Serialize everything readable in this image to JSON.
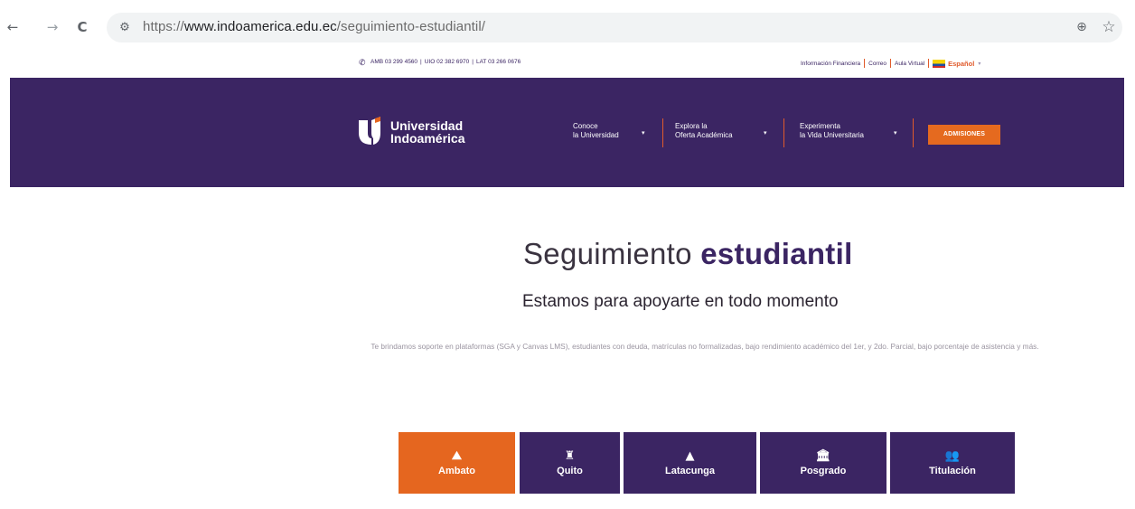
{
  "browser": {
    "back_icon": "←",
    "forward_icon": "→",
    "reload_icon": "C",
    "site_info_icon": "⚙",
    "url_scheme": "https://",
    "url_host": "www.indoamerica.edu.ec",
    "url_path": "/seguimiento-estudiantil/",
    "zoom_icon": "⊕",
    "bookmark_icon": "☆"
  },
  "topbar": {
    "phone_icon": "✆",
    "phones": [
      "AMB 03 299 4560",
      "UIO 02 382 6970",
      "LAT 03 266 0676"
    ],
    "links": [
      "Información Financiera",
      "Correo",
      "Aula Virtual"
    ],
    "language": "Español",
    "language_caret": "▾"
  },
  "header": {
    "logo_line1": "Universidad",
    "logo_line2": "Indoamérica",
    "menu": [
      {
        "line1": "Conoce",
        "line2": "la Universidad"
      },
      {
        "line1": "Explora la",
        "line2": "Oferta Académica"
      },
      {
        "line1": "Experimenta",
        "line2": "la Vida Universitaria"
      }
    ],
    "menu_caret": "▾",
    "cta": "ADMISIONES"
  },
  "main": {
    "title_light": "Seguimiento ",
    "title_bold": "estudiantil",
    "subtitle": "Estamos para apoyarte en todo momento",
    "description": "Te brindamos soporte en plataformas (SGA y Canvas LMS), estudiantes con deuda, matrículas no formalizadas, bajo rendimiento académico del 1er, y 2do. Parcial, bajo porcentaje de asistencia y más."
  },
  "campus_buttons": [
    {
      "label": "Ambato",
      "icon": "⛰",
      "icon_name": "mountains-icon"
    },
    {
      "label": "Quito",
      "icon": "♜",
      "icon_name": "monument-icon"
    },
    {
      "label": "Latacunga",
      "icon": "▲",
      "icon_name": "volcano-icon"
    },
    {
      "label": "Posgrado",
      "icon": "🏛",
      "icon_name": "institution-icon"
    },
    {
      "label": "Titulación",
      "icon": "👥",
      "icon_name": "users-icon"
    }
  ],
  "colors": {
    "brand_purple": "#3b2563",
    "brand_orange": "#e5661f"
  }
}
